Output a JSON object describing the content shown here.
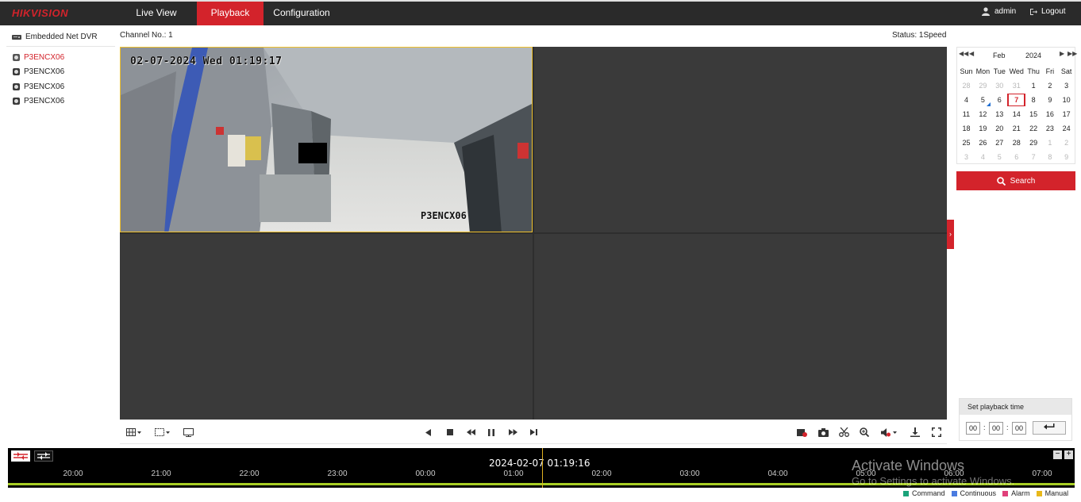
{
  "header": {
    "logo": "HIKVISION",
    "tabs": [
      {
        "label": "Live View"
      },
      {
        "label": "Playback"
      },
      {
        "label": "Configuration"
      }
    ],
    "active_tab": "Playback",
    "user": "admin",
    "logout": "Logout",
    "accent_color": "#d3232b"
  },
  "tree": {
    "device": "Embedded Net DVR",
    "cameras": [
      {
        "label": "P3ENCX06",
        "active": true
      },
      {
        "label": "P3ENCX06",
        "active": false
      },
      {
        "label": "P3ENCX06",
        "active": false
      },
      {
        "label": "P3ENCX06",
        "active": false
      }
    ]
  },
  "player": {
    "channel": "Channel No.: 1",
    "status": "Status: 1Speed",
    "osd_datetime": "02-07-2024 Wed 01:19:17",
    "osd_name": "P3ENCX06"
  },
  "calendar": {
    "month": "Feb",
    "year": "2024",
    "weekdays": [
      "Sun",
      "Mon",
      "Tue",
      "Wed",
      "Thu",
      "Fri",
      "Sat"
    ],
    "weeks": [
      [
        "28",
        "29",
        "30",
        "31",
        "1",
        "2",
        "3"
      ],
      [
        "4",
        "5",
        "6",
        "7",
        "8",
        "9",
        "10"
      ],
      [
        "11",
        "12",
        "13",
        "14",
        "15",
        "16",
        "17"
      ],
      [
        "18",
        "19",
        "20",
        "21",
        "22",
        "23",
        "24"
      ],
      [
        "25",
        "26",
        "27",
        "28",
        "29",
        "1",
        "2"
      ],
      [
        "3",
        "4",
        "5",
        "6",
        "7",
        "8",
        "9"
      ]
    ],
    "selected": "7",
    "search_label": "Search"
  },
  "playback_time": {
    "title": "Set playback time",
    "hh": "00",
    "mm": "00",
    "ss": "00"
  },
  "timeline": {
    "datetime": "2024-02-07 01:19:16",
    "hours": [
      "20:00",
      "21:00",
      "22:00",
      "23:00",
      "00:00",
      "01:00",
      "02:00",
      "03:00",
      "04:00",
      "05:00",
      "06:00",
      "07:00"
    ],
    "watermark_line1": "Activate Windows",
    "watermark_line2": "Go to Settings to activate Windows."
  },
  "legend": [
    {
      "label": "Command",
      "color": "#1aa37a"
    },
    {
      "label": "Continuous",
      "color": "#4a7be0"
    },
    {
      "label": "Alarm",
      "color": "#e0407a"
    },
    {
      "label": "Manual",
      "color": "#e8b81a"
    }
  ]
}
